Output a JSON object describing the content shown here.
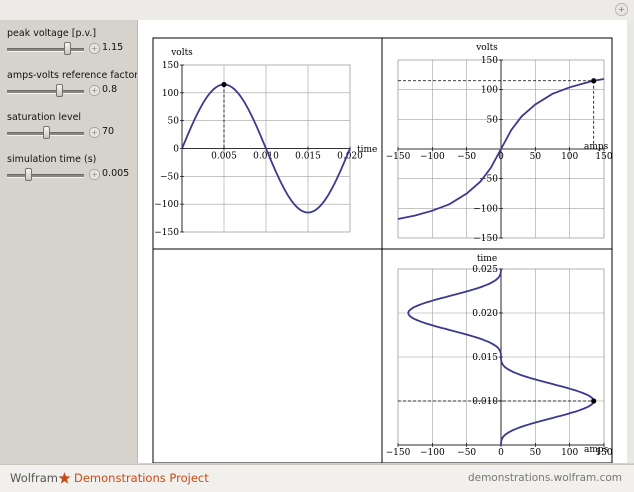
{
  "controls": [
    {
      "label": "peak voltage [p.v.]",
      "value": "1.15",
      "fraction": 0.82
    },
    {
      "label": "amps-volts reference factor",
      "value": "0.8",
      "fraction": 0.7
    },
    {
      "label": "saturation level",
      "value": "70",
      "fraction": 0.52
    },
    {
      "label": "simulation time (s)",
      "value": "0.005",
      "fraction": 0.25
    }
  ],
  "plot_labels": {
    "volts": "volts",
    "time": "time",
    "amps": "amps"
  },
  "footer": {
    "brand_wolfram": "Wolfram",
    "brand_project": "Demonstrations Project",
    "site": "demonstrations.wolfram.com"
  },
  "colors": {
    "curve": "#3b3a8e",
    "grid": "#a0a0a0",
    "brand_accent": "#c74c16"
  },
  "chart_data": [
    {
      "type": "line",
      "name_hint": "voltage vs time",
      "xlabel": "time",
      "ylabel": "volts",
      "xlim": [
        0,
        0.02
      ],
      "ylim": [
        -150,
        150
      ],
      "xticks": [
        "0.005",
        "0.010",
        "0.015",
        "0.020"
      ],
      "yticks": [
        "150",
        "100",
        "50",
        "0",
        "-50",
        "-100",
        "-150"
      ],
      "amplitude": 115,
      "frequency_hz": 50,
      "marker": {
        "x": 0.005,
        "y": 115
      }
    },
    {
      "type": "line",
      "name_hint": "volts vs amps saturation curve",
      "xlabel": "amps",
      "ylabel": "volts",
      "xlim": [
        -150,
        150
      ],
      "ylim": [
        -150,
        150
      ],
      "xticks": [
        "-150",
        "-100",
        "-50",
        "0",
        "50",
        "100",
        "150"
      ],
      "yticks": [
        "150",
        "100",
        "50",
        "0",
        "-50",
        "-100",
        "-150"
      ],
      "points": [
        [
          -150,
          -118
        ],
        [
          -125,
          -112
        ],
        [
          -100,
          -104
        ],
        [
          -75,
          -93
        ],
        [
          -50,
          -75
        ],
        [
          -30,
          -55
        ],
        [
          -15,
          -32
        ],
        [
          0,
          0
        ],
        [
          15,
          32
        ],
        [
          30,
          55
        ],
        [
          50,
          75
        ],
        [
          75,
          93
        ],
        [
          100,
          104
        ],
        [
          125,
          112
        ],
        [
          135,
          115
        ],
        [
          150,
          118
        ]
      ],
      "marker": {
        "x": 135,
        "y": 115
      }
    },
    {
      "type": "line",
      "name_hint": "current vs time",
      "xlabel": "amps",
      "ylabel": "time",
      "xlim": [
        -150,
        150
      ],
      "ylim": [
        0.005,
        0.025
      ],
      "xticks": [
        "-150",
        "-100",
        "-50",
        "0",
        "50",
        "100",
        "150"
      ],
      "yticks": [
        "0.025",
        "0.020",
        "0.015",
        "0.010"
      ],
      "amplitude": 135,
      "marker": {
        "x": 135,
        "y": 0.01
      }
    }
  ]
}
